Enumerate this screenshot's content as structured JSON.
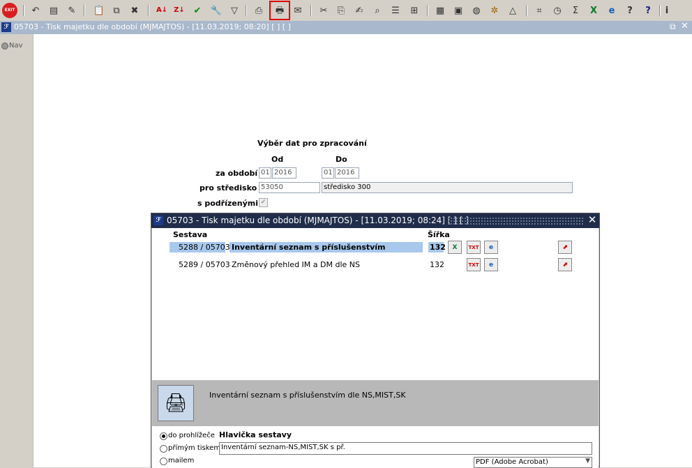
{
  "toolbar": {
    "exit_label": "EXIT",
    "icons": [
      "undo-icon",
      "folder-icon",
      "save-icon",
      "clipboard-icon",
      "copy-record-icon",
      "delete-record-icon",
      "sort-ascending-icon",
      "sort-descending-icon",
      "confirm-check-icon",
      "filter-wrench-icon",
      "filter-icon",
      "print-icon",
      "print-preview-icon",
      "email-icon",
      "cut-icon",
      "paste-icon",
      "edit-icon",
      "zoom-icon",
      "list-icon",
      "tree-icon",
      "document-icon",
      "save-doc-icon",
      "globe-icon",
      "wheel-icon",
      "warning-icon",
      "chart-icon",
      "clock-icon",
      "sum-icon",
      "excel-icon",
      "ie-icon",
      "help-query-icon",
      "help-icon",
      "info-icon"
    ]
  },
  "window": {
    "title": "05703 - Tisk majetku dle období (MJMAJTOS) - [11.03.2019; 08:20]  [ ]  [ ]",
    "logo": "ℱ"
  },
  "nav": {
    "label": "Nav"
  },
  "form": {
    "heading": "Výběr dat pro zpracování",
    "col_from": "Od",
    "col_to": "Do",
    "period_label": "za období",
    "from_month": "01",
    "from_year": "2016",
    "to_month": "01",
    "to_year": "2016",
    "center_label": "pro středisko",
    "center_code": "53050",
    "center_name": "středisko 300",
    "sub_label": "s podřízenými",
    "sub_checked": true
  },
  "dialog": {
    "title": "05703 - Tisk majetku dle období (MJMAJTOS) - [11.03.2019; 08:24]  [ ]  [ ]",
    "col_report": "Sestava",
    "col_width": "Šířka",
    "rows": [
      {
        "id": "5288 / 05703",
        "name": "Inventární seznam s příslušenstvím",
        "width": "132",
        "selected": true,
        "actions": [
          "excel-icon",
          "txt-icon",
          "ie-icon",
          "pdf-icon"
        ]
      },
      {
        "id": "5289 / 05703",
        "name": "Změnový přehled IM a DM dle NS",
        "width": "132",
        "selected": false,
        "actions": [
          "txt-icon",
          "ie-icon",
          "pdf-icon"
        ]
      }
    ],
    "description": "Inventární seznam s příslušenstvím dle NS,MIST,SK",
    "output_options": [
      {
        "label": "do prohlížeče",
        "selected": true
      },
      {
        "label": "přímým tiskem",
        "selected": false
      },
      {
        "label": "mailem",
        "selected": false
      }
    ],
    "header_label": "Hlavička sestavy",
    "header_value": "Inventární seznam-NS,MIST,SK s př.",
    "format_value": "PDF (Adobe Acrobat)"
  },
  "colors": {
    "selection": "#a8c8ec",
    "dialog_title_bg": "#1f2d4a",
    "highlight_border": "#e00000"
  }
}
